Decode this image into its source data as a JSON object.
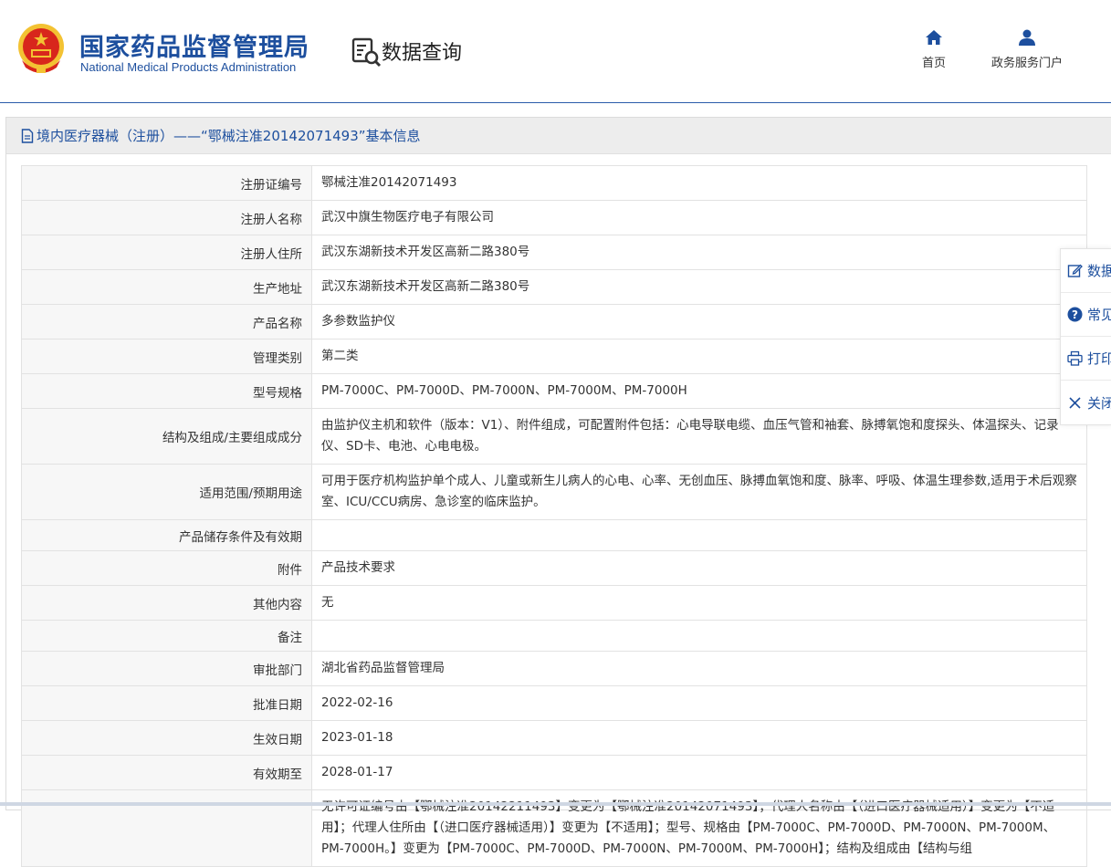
{
  "header": {
    "brand_cn": "国家药品监督管理局",
    "brand_en": "National Medical Products Administration",
    "query_title": "数据查询",
    "nav": {
      "home": "首页",
      "portal": "政务服务门户"
    },
    "colors": {
      "brand": "#1d4f9e",
      "emblem_red": "#d8261c",
      "emblem_gold": "#f3c233"
    }
  },
  "panel": {
    "title": "境内医疗器械（注册）——“鄂械注准20142071493”基本信息",
    "icon": "document-icon"
  },
  "rows": [
    {
      "key": "注册证编号",
      "value": "鄂械注准20142071493"
    },
    {
      "key": "注册人名称",
      "value": "武汉中旗生物医疗电子有限公司"
    },
    {
      "key": "注册人住所",
      "value": "武汉东湖新技术开发区高新二路380号"
    },
    {
      "key": "生产地址",
      "value": "武汉东湖新技术开发区高新二路380号"
    },
    {
      "key": "产品名称",
      "value": "多参数监护仪"
    },
    {
      "key": "管理类别",
      "value": "第二类"
    },
    {
      "key": "型号规格",
      "value": "PM-7000C、PM-7000D、PM-7000N、PM-7000M、PM-7000H"
    },
    {
      "key": "结构及组成/主要组成成分",
      "value": "由监护仪主机和软件（版本：V1）、附件组成，可配置附件包括：心电导联电缆、血压气管和袖套、脉搏氧饱和度探头、体温探头、记录仪、SD卡、电池、心电电极。"
    },
    {
      "key": "适用范围/预期用途",
      "value": "可用于医疗机构监护单个成人、儿童或新生儿病人的心电、心率、无创血压、脉搏血氧饱和度、脉率、呼吸、体温生理参数,适用于术后观察室、ICU/CCU病房、急诊室的临床监护。"
    },
    {
      "key": "产品储存条件及有效期",
      "value": ""
    },
    {
      "key": "附件",
      "value": "产品技术要求"
    },
    {
      "key": "其他内容",
      "value": "无"
    },
    {
      "key": "备注",
      "value": ""
    },
    {
      "key": "审批部门",
      "value": "湖北省药品监督管理局"
    },
    {
      "key": "批准日期",
      "value": "2022-02-16"
    },
    {
      "key": "生效日期",
      "value": "2023-01-18"
    },
    {
      "key": "有效期至",
      "value": "2028-01-17"
    },
    {
      "key": "",
      "value": "无许可证编号由【鄂械注准20142211493】变更为【鄂械注准20142071493】；代理人名称由【（进口医疗器械适用）】变更为【不适用】；代理人住所由【（进口医疗器械适用）】变更为【不适用】；型号、规格由【PM-7000C、PM-7000D、PM-7000N、PM-7000M、PM-7000H。】变更为【PM-7000C、PM-7000D、PM-7000N、PM-7000M、PM-7000H】；结构及组成由【结构与组"
    }
  ],
  "sidemenu": [
    {
      "label": "数据",
      "icon": "edit-icon"
    },
    {
      "label": "常见",
      "icon": "help-circle-icon"
    },
    {
      "label": "打印",
      "icon": "printer-icon"
    },
    {
      "label": "关闭",
      "icon": "close-icon"
    }
  ]
}
